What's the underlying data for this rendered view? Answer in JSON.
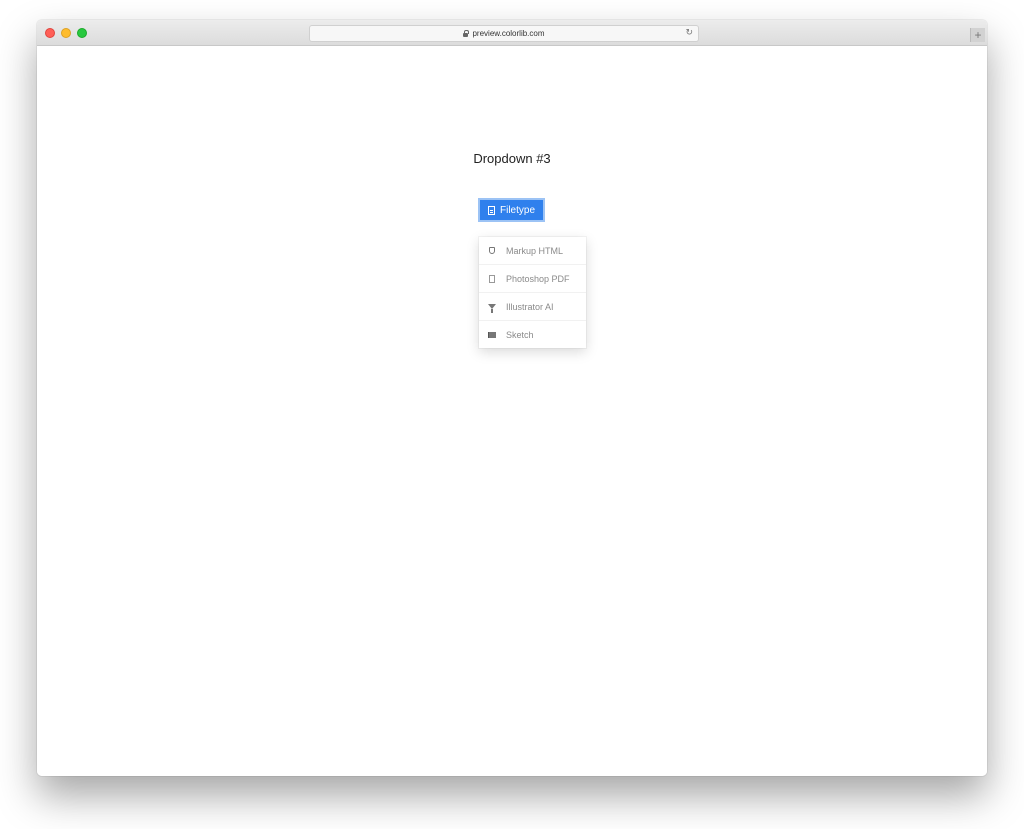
{
  "browser": {
    "url": "preview.colorlib.com",
    "newtab_label": "+",
    "reload_glyph": "↻"
  },
  "page": {
    "heading": "Dropdown #3"
  },
  "dropdown": {
    "button_label": "Filetype",
    "accent_color": "#2f80ed",
    "items": [
      {
        "label": "Markup HTML",
        "icon": "html5-shield-icon"
      },
      {
        "label": "Photoshop PDF",
        "icon": "pdf-file-icon"
      },
      {
        "label": "Illustrator AI",
        "icon": "glass-icon"
      },
      {
        "label": "Sketch",
        "icon": "flag-icon"
      }
    ]
  }
}
